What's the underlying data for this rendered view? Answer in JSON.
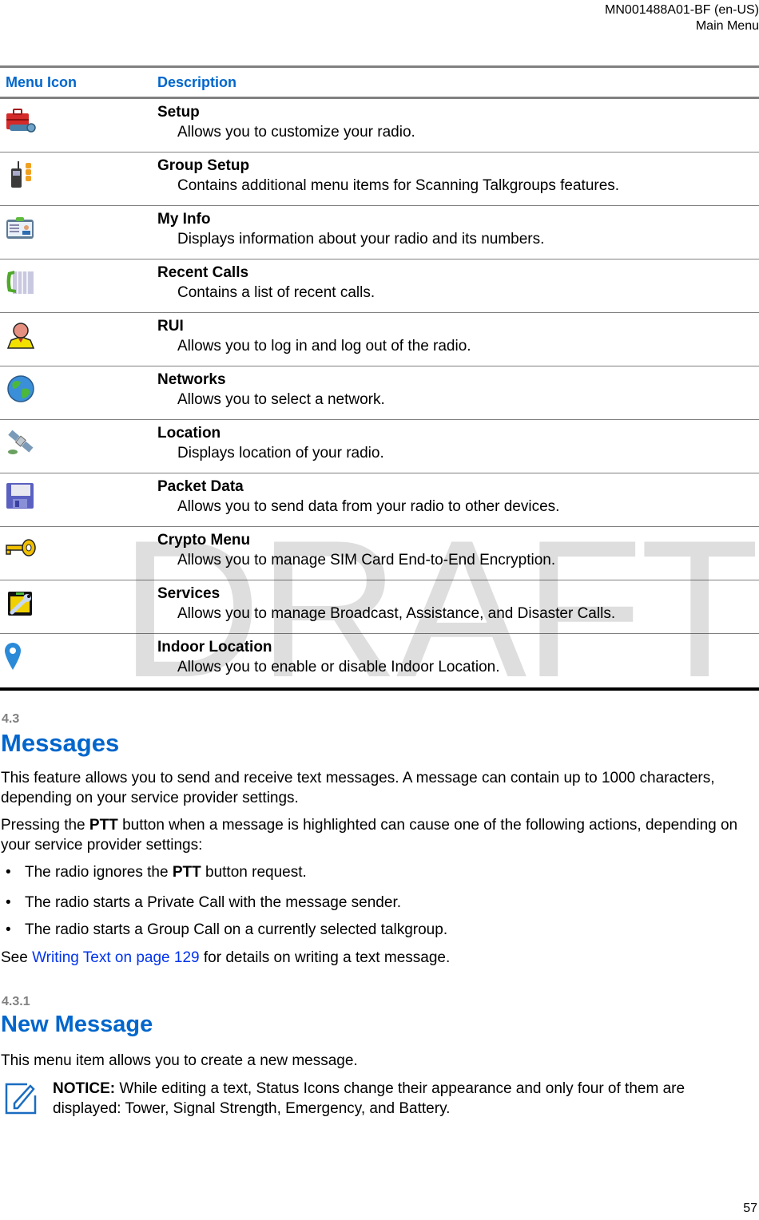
{
  "header": {
    "doc_id": "MN001488A01-BF (en-US)",
    "section": "Main Menu"
  },
  "table": {
    "col_icon": "Menu Icon",
    "col_desc": "Description",
    "rows": [
      {
        "icon": "setup-toolbox-icon",
        "title": "Setup",
        "desc": "Allows you to customize your radio."
      },
      {
        "icon": "group-setup-radio-icon",
        "title": "Group Setup",
        "desc": "Contains additional menu items for Scanning Talkgroups features."
      },
      {
        "icon": "my-info-id-card-icon",
        "title": "My Info",
        "desc": "Displays information about your radio and its numbers."
      },
      {
        "icon": "recent-calls-phone-icon",
        "title": "Recent Calls",
        "desc": "Contains a list of recent calls."
      },
      {
        "icon": "rui-user-icon",
        "title": "RUI",
        "desc": "Allows you to log in and log out of the radio."
      },
      {
        "icon": "networks-globe-icon",
        "title": "Networks",
        "desc": "Allows you to select a network."
      },
      {
        "icon": "location-satellite-icon",
        "title": "Location",
        "desc": "Displays location of your radio."
      },
      {
        "icon": "packet-data-floppy-icon",
        "title": "Packet Data",
        "desc": "Allows you to send data from your radio to other devices."
      },
      {
        "icon": "crypto-key-icon",
        "title": "Crypto Menu",
        "desc": "Allows you to manage SIM Card End-to-End Encryption."
      },
      {
        "icon": "services-wrench-icon",
        "title": "Services",
        "desc": "Allows you to manage Broadcast, Assistance, and Disaster Calls."
      },
      {
        "icon": "indoor-location-pin-icon",
        "title": "Indoor Location",
        "desc": "Allows you to enable or disable Indoor Location."
      }
    ]
  },
  "watermark": "DRAFT",
  "messages": {
    "number": "4.3",
    "title": "Messages",
    "para1": "This feature allows you to send and receive text messages. A message can contain up to 1000 characters, depending on your service provider settings.",
    "para2_pre": "Pressing the ",
    "para2_bold": "PTT",
    "para2_post": " button when a message is highlighted can cause one of the following actions, depending on your service provider settings:",
    "bullet_char": "•",
    "bullet1_pre": "The radio ignores the ",
    "bullet1_bold": "PTT",
    "bullet1_post": " button request.",
    "bullet2": "The radio starts a Private Call with the message sender.",
    "bullet3": "The radio starts a Group Call on a currently selected talkgroup.",
    "see_pre": "See ",
    "see_link": "Writing Text on page 129",
    "see_post": " for details on writing a text message."
  },
  "new_message": {
    "number": "4.3.1",
    "title": "New Message",
    "para": "This menu item allows you to create a new message.",
    "notice_label": "NOTICE:",
    "notice_text": " While editing a text, Status Icons change their appearance and only four of them are displayed: Tower, Signal Strength, Emergency, and Battery."
  },
  "page_number": "57"
}
